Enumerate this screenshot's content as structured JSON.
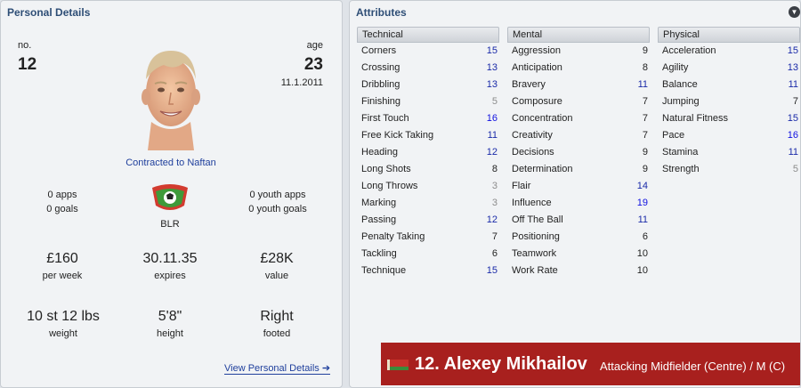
{
  "personal": {
    "title": "Personal Details",
    "no_label": "no.",
    "no_value": "12",
    "age_label": "age",
    "age_value": "23",
    "age_date": "11.1.2011",
    "contract": "Contracted to Naftan",
    "apps": "0 apps",
    "goals": "0 goals",
    "nation": "BLR",
    "youth_apps": "0 youth apps",
    "youth_goals": "0 youth goals",
    "wage_value": "£160",
    "wage_label": "per week",
    "expires_value": "30.11.35",
    "expires_label": "expires",
    "value_value": "£28K",
    "value_label": "value",
    "weight_value": "10 st 12 lbs",
    "weight_label": "weight",
    "height_value": "5'8\"",
    "height_label": "height",
    "foot_value": "Right",
    "foot_label": "footed",
    "view_link": "View Personal Details"
  },
  "attributes": {
    "title": "Attributes",
    "technical": {
      "header": "Technical",
      "rows": [
        {
          "name": "Corners",
          "value": "15",
          "tier": "high"
        },
        {
          "name": "Crossing",
          "value": "13",
          "tier": "high"
        },
        {
          "name": "Dribbling",
          "value": "13",
          "tier": "high"
        },
        {
          "name": "Finishing",
          "value": "5",
          "tier": "low"
        },
        {
          "name": "First Touch",
          "value": "16",
          "tier": "top"
        },
        {
          "name": "Free Kick Taking",
          "value": "11",
          "tier": "high"
        },
        {
          "name": "Heading",
          "value": "12",
          "tier": "high"
        },
        {
          "name": "Long Shots",
          "value": "8",
          "tier": "mid"
        },
        {
          "name": "Long Throws",
          "value": "3",
          "tier": "low"
        },
        {
          "name": "Marking",
          "value": "3",
          "tier": "low"
        },
        {
          "name": "Passing",
          "value": "12",
          "tier": "high"
        },
        {
          "name": "Penalty Taking",
          "value": "7",
          "tier": "mid"
        },
        {
          "name": "Tackling",
          "value": "6",
          "tier": "mid"
        },
        {
          "name": "Technique",
          "value": "15",
          "tier": "high"
        }
      ]
    },
    "mental": {
      "header": "Mental",
      "rows": [
        {
          "name": "Aggression",
          "value": "9",
          "tier": "mid"
        },
        {
          "name": "Anticipation",
          "value": "8",
          "tier": "mid"
        },
        {
          "name": "Bravery",
          "value": "11",
          "tier": "high"
        },
        {
          "name": "Composure",
          "value": "7",
          "tier": "mid"
        },
        {
          "name": "Concentration",
          "value": "7",
          "tier": "mid"
        },
        {
          "name": "Creativity",
          "value": "7",
          "tier": "mid"
        },
        {
          "name": "Decisions",
          "value": "9",
          "tier": "mid"
        },
        {
          "name": "Determination",
          "value": "9",
          "tier": "mid"
        },
        {
          "name": "Flair",
          "value": "14",
          "tier": "high"
        },
        {
          "name": "Influence",
          "value": "19",
          "tier": "top"
        },
        {
          "name": "Off The Ball",
          "value": "11",
          "tier": "high"
        },
        {
          "name": "Positioning",
          "value": "6",
          "tier": "mid"
        },
        {
          "name": "Teamwork",
          "value": "10",
          "tier": "mid"
        },
        {
          "name": "Work Rate",
          "value": "10",
          "tier": "mid"
        }
      ]
    },
    "physical": {
      "header": "Physical",
      "rows": [
        {
          "name": "Acceleration",
          "value": "15",
          "tier": "high"
        },
        {
          "name": "Agility",
          "value": "13",
          "tier": "high"
        },
        {
          "name": "Balance",
          "value": "11",
          "tier": "high"
        },
        {
          "name": "Jumping",
          "value": "7",
          "tier": "mid"
        },
        {
          "name": "Natural Fitness",
          "value": "15",
          "tier": "high"
        },
        {
          "name": "Pace",
          "value": "16",
          "tier": "top"
        },
        {
          "name": "Stamina",
          "value": "11",
          "tier": "high"
        },
        {
          "name": "Strength",
          "value": "5",
          "tier": "low"
        }
      ]
    }
  },
  "banner": {
    "name": "12. Alexey Mikhailov",
    "position": "Attacking Midfielder (Centre) / M (C)",
    "flag_icon": "belarus-flag-icon"
  },
  "colors": {
    "banner_bg": "#a8201e",
    "title_color": "#2e4e76",
    "value_high": "#1a2aa8"
  }
}
